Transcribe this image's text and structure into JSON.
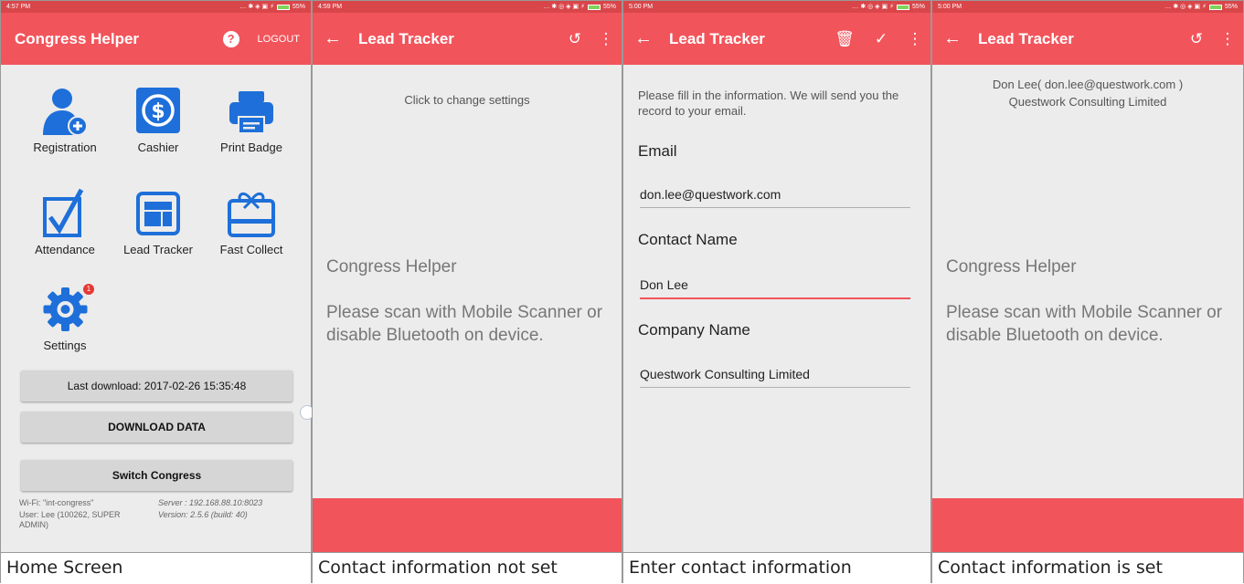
{
  "panels": [
    {
      "status_time": "4:57 PM",
      "status_batt": "55%",
      "caption": "Home Screen",
      "appbar": {
        "title": "Congress Helper",
        "help_icon": "help-icon",
        "logout": "LOGOUT"
      },
      "tiles": [
        {
          "label": "Registration",
          "icon": "add-user-icon"
        },
        {
          "label": "Cashier",
          "icon": "dollar-icon"
        },
        {
          "label": "Print Badge",
          "icon": "printer-icon"
        },
        {
          "label": "Attendance",
          "icon": "checkbox-icon"
        },
        {
          "label": "Lead Tracker",
          "icon": "lead-tracker-icon"
        },
        {
          "label": "Fast Collect",
          "icon": "gift-card-icon"
        },
        {
          "label": "Settings",
          "icon": "gear-icon",
          "badge": "1"
        }
      ],
      "last_download": "Last download: 2017-02-26 15:35:48",
      "download_button": "DOWNLOAD DATA",
      "switch_button": "Switch Congress",
      "footer": {
        "wifi": "Wi-Fi: \"int-congress\"",
        "user_line1": "User: Lee (100262, SUPER",
        "user_line2": "ADMIN)",
        "server": "Server : 192.168.88.10:8023",
        "version": "Version: 2.5.6 (build: 40)"
      }
    },
    {
      "status_time": "4:59 PM",
      "status_batt": "55%",
      "caption": "Contact information not set",
      "appbar": {
        "title": "Lead Tracker",
        "history_icon": "history-icon",
        "more_icon": "more-vert-icon"
      },
      "settings_hint": "Click to change settings",
      "message_title": "Congress Helper",
      "message_body": "Please scan with Mobile Scanner or disable Bluetooth on device."
    },
    {
      "status_time": "5:00 PM",
      "status_batt": "55%",
      "caption": "Enter contact information",
      "appbar": {
        "title": "Lead Tracker",
        "delete_icon": "delete-sweep-icon",
        "check_icon": "check-icon",
        "more_icon": "more-vert-icon"
      },
      "intro": "Please fill in the information. We will send you the record to your email.",
      "fields": [
        {
          "label": "Email",
          "value": "don.lee@questwork.com"
        },
        {
          "label": "Contact Name",
          "value": "Don Lee"
        },
        {
          "label": "Company Name",
          "value": "Questwork Consulting Limited"
        }
      ]
    },
    {
      "status_time": "5:00 PM",
      "status_batt": "55%",
      "caption": "Contact information is set",
      "appbar": {
        "title": "Lead Tracker",
        "history_icon": "history-icon",
        "more_icon": "more-vert-icon"
      },
      "contact_line1": "Don Lee( don.lee@questwork.com )",
      "contact_line2": "Questwork Consulting Limited",
      "message_title": "Congress Helper",
      "message_body": "Please scan with Mobile Scanner or disable Bluetooth on device."
    }
  ],
  "colors": {
    "accent": "#f2545b",
    "icon_blue": "#1e6fd9",
    "background": "#ececec"
  }
}
